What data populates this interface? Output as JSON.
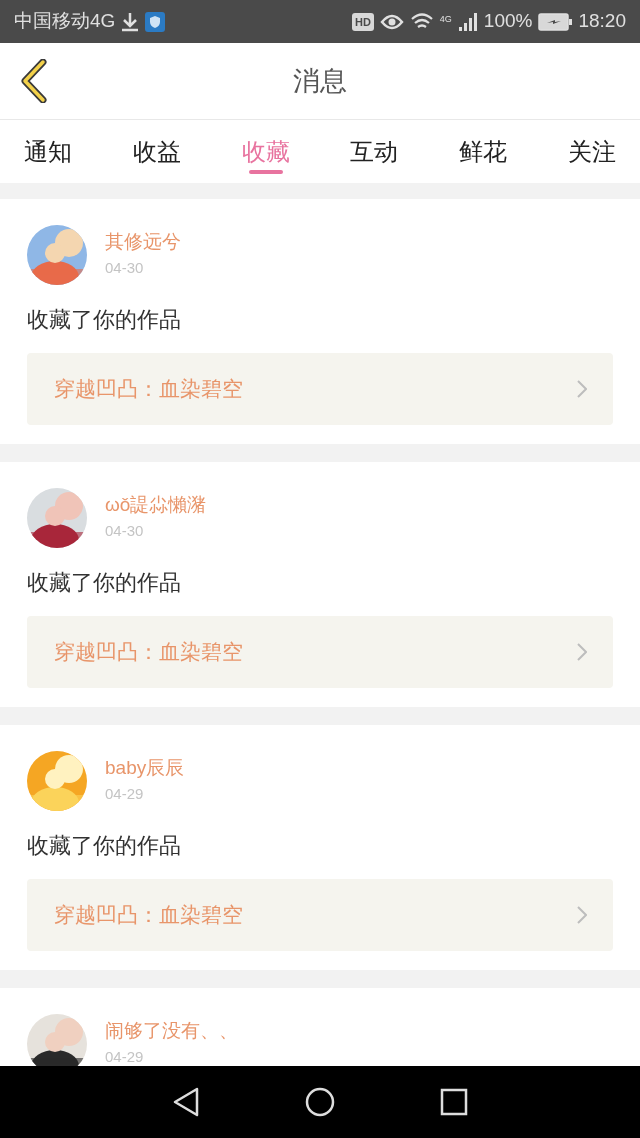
{
  "status_bar": {
    "carrier": "中国移动4G",
    "hd": "HD",
    "network": "4G",
    "battery": "100%",
    "time": "18:20"
  },
  "header": {
    "title": "消息"
  },
  "tabs": [
    {
      "label": "通知",
      "selected": false
    },
    {
      "label": "收益",
      "selected": false
    },
    {
      "label": "收藏",
      "selected": true
    },
    {
      "label": "互动",
      "selected": false
    },
    {
      "label": "鲜花",
      "selected": false
    },
    {
      "label": "关注",
      "selected": false
    }
  ],
  "messages": [
    {
      "name": "其修远兮",
      "date": "04-30",
      "text": "收藏了你的作品",
      "work": "穿越凹凸：血染碧空"
    },
    {
      "name": "ωǒ諟尛懶潴",
      "date": "04-30",
      "text": "收藏了你的作品",
      "work": "穿越凹凸：血染碧空"
    },
    {
      "name": "baby辰辰",
      "date": "04-29",
      "text": "收藏了你的作品",
      "work": "穿越凹凸：血染碧空"
    },
    {
      "name": "闹够了没有、、",
      "date": "04-29"
    }
  ]
}
